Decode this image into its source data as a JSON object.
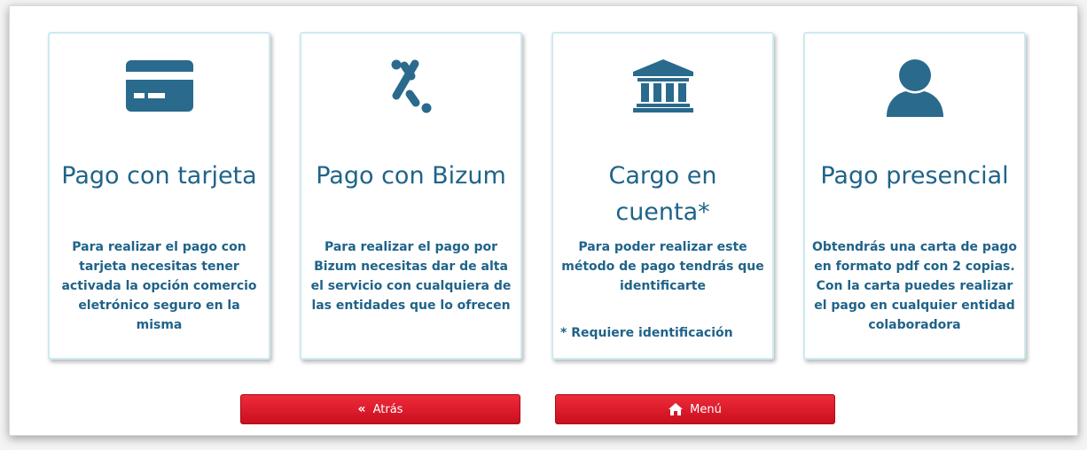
{
  "cards": [
    {
      "icon": "credit-card-icon",
      "title": "Pago con tarjeta",
      "description": "Para realizar el pago con tarjeta necesitas tener activada la opción comercio eletrónico seguro en la misma"
    },
    {
      "icon": "bizum-icon",
      "title": "Pago con Bizum",
      "description": "Para realizar el pago por Bizum necesitas dar de alta el servicio con cualquiera de las entidades que lo ofrecen"
    },
    {
      "icon": "bank-icon",
      "title": "Cargo en cuenta*",
      "description": "Para poder realizar este método de pago tendrás que identificarte",
      "note": "* Requiere identificación"
    },
    {
      "icon": "user-icon",
      "title": "Pago presencial",
      "description": "Obtendrás una carta de pago en formato pdf con 2 copias. Con la carta puedes realizar el pago en cualquier entidad colaboradora"
    }
  ],
  "buttons": {
    "back_label": "Atrás",
    "back_icon": "«",
    "menu_label": "Menú",
    "menu_icon": "home-icon"
  },
  "colors": {
    "primary": "#1f6389",
    "button_red": "#e11d2b",
    "card_border": "#cdeaf1"
  }
}
